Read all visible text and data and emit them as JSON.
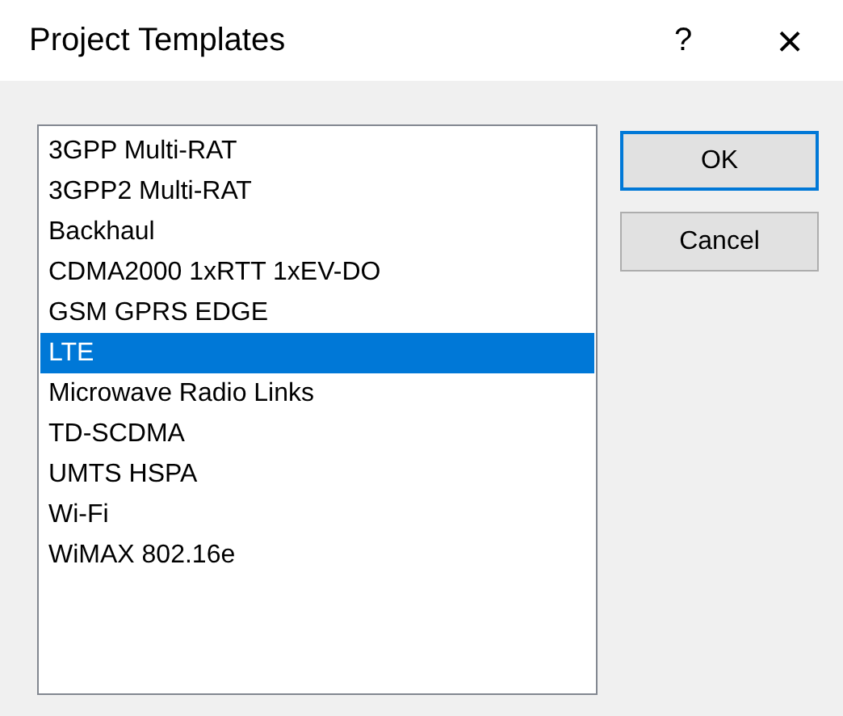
{
  "window": {
    "title": "Project Templates",
    "help": "?",
    "close": "×"
  },
  "templates": [
    {
      "label": "3GPP Multi-RAT",
      "selected": false
    },
    {
      "label": "3GPP2 Multi-RAT",
      "selected": false
    },
    {
      "label": "Backhaul",
      "selected": false
    },
    {
      "label": "CDMA2000 1xRTT 1xEV-DO",
      "selected": false
    },
    {
      "label": "GSM GPRS EDGE",
      "selected": false
    },
    {
      "label": "LTE",
      "selected": true
    },
    {
      "label": "Microwave Radio Links",
      "selected": false
    },
    {
      "label": "TD-SCDMA",
      "selected": false
    },
    {
      "label": "UMTS HSPA",
      "selected": false
    },
    {
      "label": "Wi-Fi",
      "selected": false
    },
    {
      "label": "WiMAX 802.16e",
      "selected": false
    }
  ],
  "buttons": [
    {
      "label": "OK",
      "default": true
    },
    {
      "label": "Cancel",
      "default": false
    }
  ]
}
